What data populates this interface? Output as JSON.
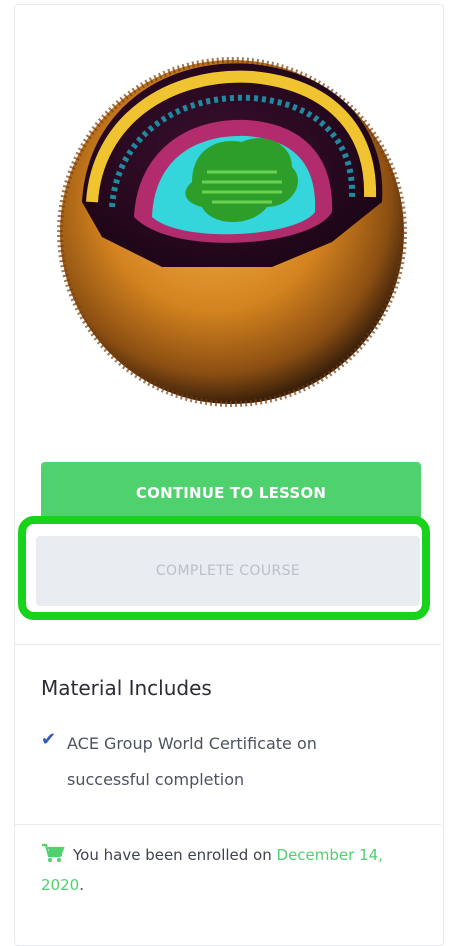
{
  "course_card": {
    "image_icon": "virus-3d-illustration",
    "buttons": {
      "continue_label": "CONTINUE TO LESSON",
      "complete_label": "COMPLETE COURSE"
    },
    "highlight_color": "#18d21b"
  },
  "material": {
    "title": "Material Includes",
    "items": [
      {
        "icon": "check-icon",
        "text": "ACE Group World Certificate on successful completion"
      }
    ]
  },
  "enrollment": {
    "icon": "cart-icon",
    "text": "You have been enrolled on",
    "date": "December 14, 2020",
    "suffix": "."
  },
  "colors": {
    "accent": "#4fd16d",
    "disabled_bg": "#e9ecf1",
    "disabled_text": "#b9c0cb",
    "check": "#2f5bbf"
  }
}
